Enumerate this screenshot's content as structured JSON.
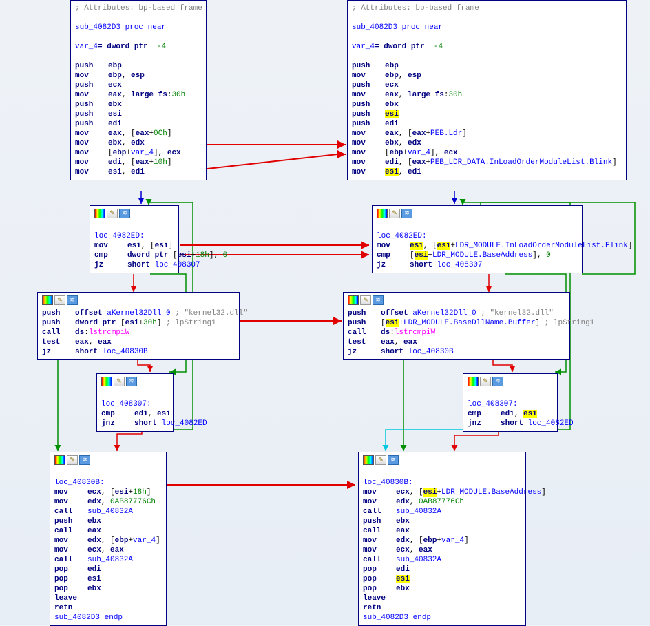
{
  "left": {
    "n1": {
      "comment": "; Attributes: bp-based frame",
      "proc": "sub_4082D3 proc near",
      "var": "var_4= dword ptr -4",
      "lines": [
        "push    ebp",
        "mov     ebp, esp",
        "push    ecx",
        "mov     eax, large fs:30h",
        "push    ebx",
        "push    esi",
        "push    edi",
        "mov     eax, [eax+0Ch]",
        "mov     ebx, edx",
        "mov     [ebp+var_4], ecx",
        "mov     edi, [eax+10h]",
        "mov     esi, edi"
      ]
    },
    "n2": {
      "label": "loc_4082ED:",
      "lines": [
        "mov     esi, [esi]",
        "cmp     dword ptr [esi+18h], 0",
        "jz      short loc_408307"
      ]
    },
    "n3": {
      "lines": [
        "push    offset aKernel32Dll_0 ; \"kernel32.dll\"",
        "push    dword ptr [esi+30h] ; lpString1",
        "call    ds:lstrcmpiW",
        "test    eax, eax",
        "jz      short loc_40830B"
      ]
    },
    "n4": {
      "label": "loc_408307:",
      "lines": [
        "cmp     edi, esi",
        "jnz     short loc_4082ED"
      ]
    },
    "n5": {
      "label": "loc_40830B:",
      "lines": [
        "mov     ecx, [esi+18h]",
        "mov     edx, 0AB87776Ch",
        "call    sub_40832A",
        "push    ebx",
        "call    eax",
        "mov     edx, [ebp+var_4]",
        "mov     ecx, eax",
        "call    sub_40832A",
        "pop     edi",
        "pop     esi",
        "pop     ebx",
        "leave",
        "retn",
        "sub_4082D3 endp"
      ]
    }
  },
  "right": {
    "n1": {
      "comment": "; Attributes: bp-based frame",
      "proc": "sub_4082D3 proc near",
      "var": "var_4= dword ptr -4",
      "lines": [
        "push    ebp",
        "mov     ebp, esp",
        "push    ecx",
        "mov     eax, large fs:30h",
        "push    ebx",
        "push    esi",
        "push    edi",
        "mov     eax, [eax+PEB.Ldr]",
        "mov     ebx, edx",
        "mov     [ebp+var_4], ecx",
        "mov     edi, [eax+PEB_LDR_DATA.InLoadOrderModuleList.Blink]",
        "mov     esi, edi"
      ]
    },
    "n2": {
      "label": "loc_4082ED:",
      "lines": [
        "mov     esi, [esi+LDR_MODULE.InLoadOrderModuleList.Flink]",
        "cmp     [esi+LDR_MODULE.BaseAddress], 0",
        "jz      short loc_408307"
      ]
    },
    "n3": {
      "lines": [
        "push    offset aKernel32Dll_0 ; \"kernel32.dll\"",
        "push    [esi+LDR_MODULE.BaseDllName.Buffer] ; lpString1",
        "call    ds:lstrcmpiW",
        "test    eax, eax",
        "jz      short loc_40830B"
      ]
    },
    "n4": {
      "label": "loc_408307:",
      "lines": [
        "cmp     edi, esi",
        "jnz     short loc_4082ED"
      ]
    },
    "n5": {
      "label": "loc_40830B:",
      "lines": [
        "mov     ecx, [esi+LDR_MODULE.BaseAddress]",
        "mov     edx, 0AB87776Ch",
        "call    sub_40832A",
        "push    ebx",
        "call    eax",
        "mov     edx, [ebp+var_4]",
        "mov     ecx, eax",
        "call    sub_40832A",
        "pop     edi",
        "pop     esi",
        "pop     ebx",
        "leave",
        "retn",
        "sub_4082D3 endp"
      ]
    }
  }
}
